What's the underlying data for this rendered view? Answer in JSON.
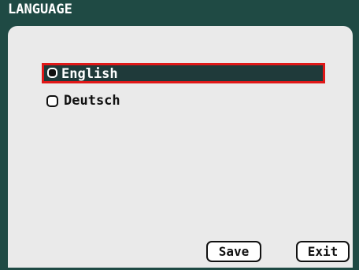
{
  "window": {
    "title": "LANGUAGE"
  },
  "languages": {
    "options": [
      {
        "label": "English",
        "selected": true
      },
      {
        "label": "Deutsch",
        "selected": false
      }
    ]
  },
  "buttons": {
    "save_label": "Save",
    "exit_label": "Exit"
  },
  "colors": {
    "title_bar": "#1f4a44",
    "panel_background": "#eaeaea",
    "selected_row": "#1f3a3a",
    "focus_border": "#e01818"
  }
}
